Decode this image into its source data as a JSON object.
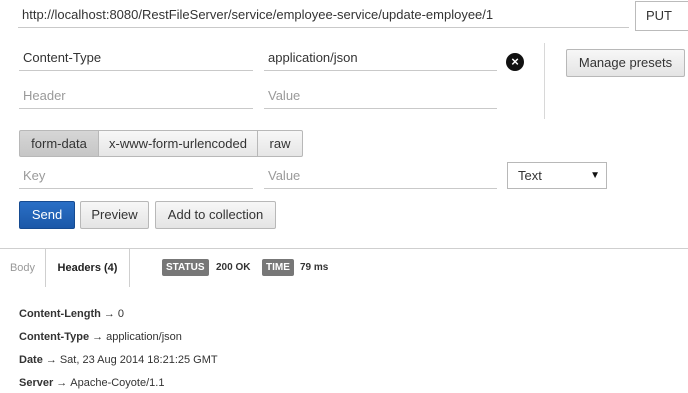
{
  "request": {
    "url": "http://localhost:8080/RestFileServer/service/employee-service/update-employee/1",
    "method": "PUT"
  },
  "headers_editor": {
    "row1_key": "Content-Type",
    "row1_value": "application/json",
    "row2_key_placeholder": "Header",
    "row2_value_placeholder": "Value",
    "manage_presets_label": "Manage presets"
  },
  "body_modes": {
    "form_data": "form-data",
    "urlencoded": "x-www-form-urlencoded",
    "raw": "raw",
    "active": "form-data"
  },
  "form_row": {
    "key_placeholder": "Key",
    "value_placeholder": "Value",
    "type_selected": "Text"
  },
  "actions": {
    "send": "Send",
    "preview": "Preview",
    "add_to_collection": "Add to collection"
  },
  "response": {
    "tabs": {
      "body": "Body",
      "headers": "Headers (4)"
    },
    "status_label": "STATUS",
    "status_value": "200 OK",
    "time_label": "TIME",
    "time_value": "79 ms",
    "headers": [
      {
        "key": "Content-Length",
        "value": "0"
      },
      {
        "key": "Content-Type",
        "value": "application/json"
      },
      {
        "key": "Date",
        "value": "Sat, 23 Aug 2014 18:21:25 GMT"
      },
      {
        "key": "Server",
        "value": "Apache-Coyote/1.1"
      }
    ],
    "arrow": "→"
  },
  "colors": {
    "primary_button": "#1b58a8",
    "badge": "#777777"
  },
  "icons": {
    "remove_header": "close-icon",
    "type_dropdown": "caret-down-icon"
  }
}
